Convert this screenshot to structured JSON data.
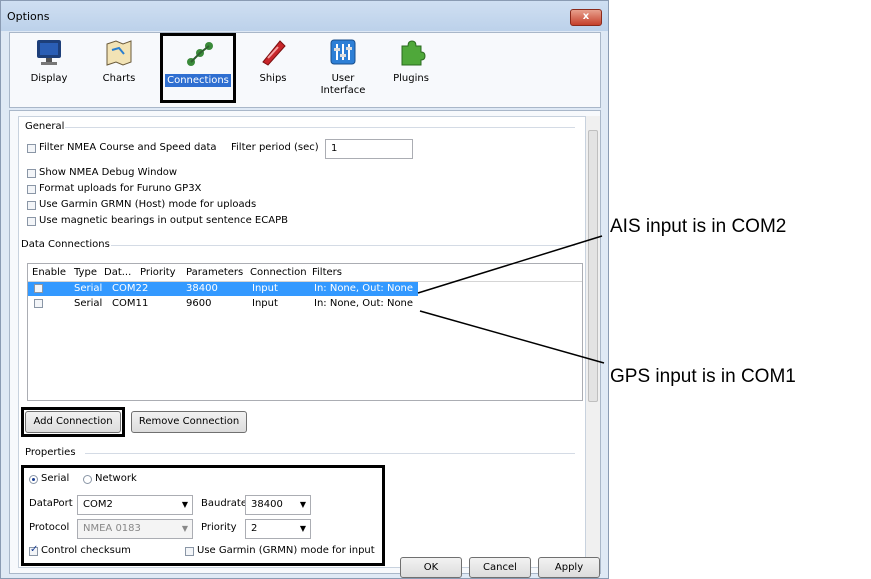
{
  "window": {
    "title": "Options",
    "close_label": "x"
  },
  "toolbar": {
    "items": [
      {
        "label": "Display",
        "icon": "monitor-icon"
      },
      {
        "label": "Charts",
        "icon": "charts-icon"
      },
      {
        "label": "Connections",
        "icon": "connections-icon",
        "selected": true
      },
      {
        "label": "Ships",
        "icon": "ship-icon"
      },
      {
        "label": "User Interface",
        "icon": "user-interface-icon"
      },
      {
        "label": "Plugins",
        "icon": "puzzle-icon"
      }
    ]
  },
  "general": {
    "heading": "General",
    "filter_nmea": "Filter NMEA Course and Speed data",
    "filter_period_label": "Filter period (sec)",
    "filter_period_value": "1",
    "show_debug": "Show NMEA Debug Window",
    "format_uploads": "Format uploads for Furuno GP3X",
    "use_garmin": "Use Garmin GRMN (Host) mode for uploads",
    "use_magnetic": "Use magnetic bearings in output sentence ECAPB"
  },
  "data_connections": {
    "heading": "Data Connections",
    "columns": [
      "Enable",
      "Type",
      "Dat...",
      "Priority",
      "Parameters",
      "Connection",
      "Filters"
    ],
    "rows": [
      {
        "type": "Serial",
        "port": "COM2",
        "priority": "2",
        "params": "38400",
        "conn": "Input",
        "filters": "In: None, Out: None",
        "selected": true
      },
      {
        "type": "Serial",
        "port": "COM1",
        "priority": "1",
        "params": "9600",
        "conn": "Input",
        "filters": "In: None, Out: None",
        "selected": false
      }
    ],
    "add_label": "Add Connection",
    "remove_label": "Remove Connection"
  },
  "properties": {
    "heading": "Properties",
    "serial_label": "Serial",
    "network_label": "Network",
    "dataport_label": "DataPort",
    "dataport_value": "COM2",
    "baudrate_label": "Baudrate",
    "baudrate_value": "38400",
    "protocol_label": "Protocol",
    "protocol_value": "NMEA 0183",
    "priority_label": "Priority",
    "priority_value": "2",
    "control_checksum": "Control checksum",
    "use_garmin_input": "Use Garmin (GRMN) mode for input"
  },
  "buttons": {
    "ok": "OK",
    "cancel": "Cancel",
    "apply": "Apply"
  },
  "annotations": {
    "ais": "AIS input is in COM2",
    "gps": "GPS input is in COM1"
  },
  "colors": {
    "selection": "#3399ff",
    "accent": "#2f6fd1",
    "highlight_box": "#000000"
  }
}
